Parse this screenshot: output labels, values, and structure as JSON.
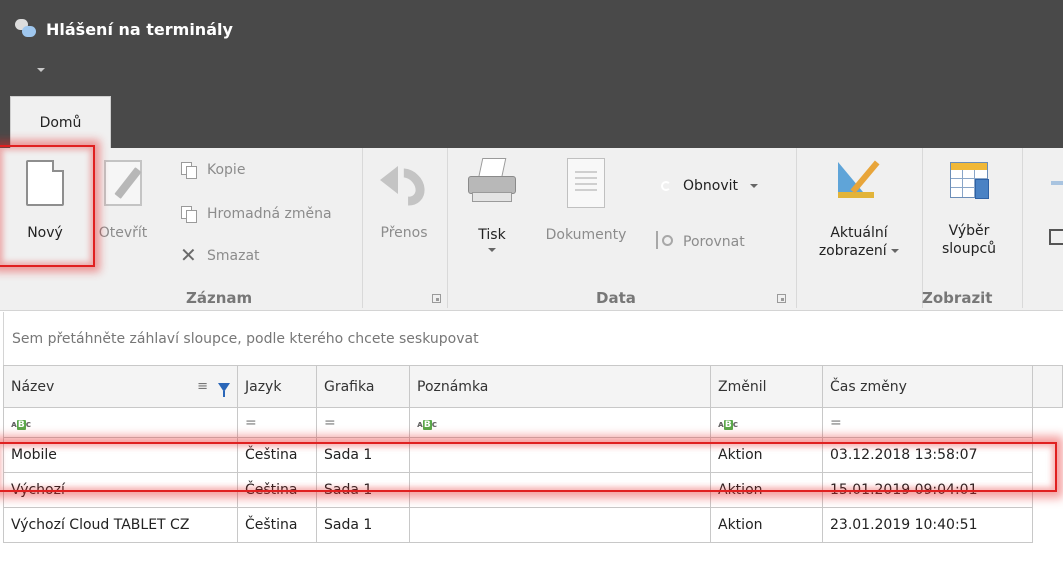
{
  "app": {
    "title": "Hlášení na terminály"
  },
  "tabs": [
    {
      "label": "Domů",
      "active": true
    }
  ],
  "ribbon": {
    "groups": {
      "zaznam": {
        "label": "Záznam",
        "novy": "Nový",
        "otevrit": "Otevřít",
        "kopie": "Kopie",
        "hromadna_zmena": "Hromadná změna",
        "smazat": "Smazat"
      },
      "prenos": {
        "label": "Přenos"
      },
      "data": {
        "label": "Data",
        "tisk": "Tisk",
        "dokumenty": "Dokumenty",
        "obnovit": "Obnovit",
        "porovnat": "Porovnat"
      },
      "zobrazit": {
        "label": "Zobrazit",
        "aktualni_line1": "Aktuální",
        "aktualni_line2": "zobrazení",
        "vyber_line1": "Výběr",
        "vyber_line2": "sloupců"
      }
    }
  },
  "grid": {
    "group_hint": "Sem přetáhněte záhlaví sloupce, podle kterého chcete seskupovat",
    "columns": [
      "Název",
      "Jazyk",
      "Grafika",
      "Poznámka",
      "Změnil",
      "Čas změny"
    ],
    "filter_row": [
      "ABC",
      "=",
      "=",
      "ABC",
      "ABC",
      "="
    ],
    "rows": [
      {
        "nazev": "Mobile",
        "jazyk": "Čeština",
        "grafika": "Sada 1",
        "poznamka": "",
        "zmenil": "Aktion",
        "cas": "03.12.2018 13:58:07"
      },
      {
        "nazev": "Výchozí",
        "jazyk": "Čeština",
        "grafika": "Sada 1",
        "poznamka": "",
        "zmenil": "Aktion",
        "cas": "15.01.2019 09:04:01"
      },
      {
        "nazev": "Výchozí Cloud TABLET CZ",
        "jazyk": "Čeština",
        "grafika": "Sada 1",
        "poznamka": "",
        "zmenil": "Aktion",
        "cas": "23.01.2019 10:40:51"
      }
    ]
  },
  "icons": {
    "app": "chat-bubbles-icon",
    "novy": "new-document-icon",
    "otevrit": "edit-document-icon",
    "kopie": "copy-icon",
    "hromadna_zmena": "bulk-edit-icon",
    "smazat": "delete-x-icon",
    "prenos": "undo-arrow-icon",
    "tisk": "printer-icon",
    "dokumenty": "documents-icon",
    "obnovit": "refresh-icon",
    "porovnat": "compare-icon",
    "aktualni": "view-design-icon",
    "vyber": "column-chooser-icon"
  },
  "colors": {
    "header_bg": "#494949",
    "ribbon_bg": "#f0f0f0",
    "highlight": "#e02020",
    "filter_icon": "#2a66b8"
  }
}
